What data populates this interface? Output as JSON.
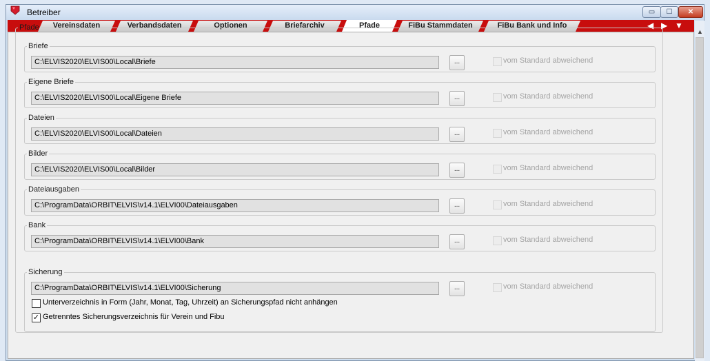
{
  "window": {
    "title": "Betreiber",
    "buttons": {
      "minimize": "▭",
      "maximize": "☐",
      "close": "✕"
    }
  },
  "tabs": [
    {
      "label": "Vereinsdaten",
      "active": false
    },
    {
      "label": "Verbandsdaten",
      "active": false
    },
    {
      "label": "Optionen",
      "active": false
    },
    {
      "label": "Briefarchiv",
      "active": false
    },
    {
      "label": "Pfade",
      "active": true
    },
    {
      "label": "FiBu Stammdaten",
      "active": false
    },
    {
      "label": "FiBu Bank und Info",
      "active": false
    }
  ],
  "tab_nav": {
    "prev": "◀",
    "next": "▶",
    "menu": "▼"
  },
  "scrollbar": {
    "up": "▲"
  },
  "pfade": {
    "title": "Pfade",
    "browse_label": "...",
    "std_label": "vom Standard abweichend",
    "groups": [
      {
        "title": "Briefe",
        "path": "C:\\ELVIS2020\\ELVIS00\\Local\\Briefe"
      },
      {
        "title": "Eigene Briefe",
        "path": "C:\\ELVIS2020\\ELVIS00\\Local\\Eigene Briefe"
      },
      {
        "title": "Dateien",
        "path": "C:\\ELVIS2020\\ELVIS00\\Local\\Dateien"
      },
      {
        "title": "Bilder",
        "path": "C:\\ELVIS2020\\ELVIS00\\Local\\Bilder"
      },
      {
        "title": "Dateiausgaben",
        "path": "C:\\ProgramData\\ORBIT\\ELVIS\\v14.1\\ELVI00\\Dateiausgaben"
      },
      {
        "title": "Bank",
        "path": "C:\\ProgramData\\ORBIT\\ELVIS\\v14.1\\ELVI00\\Bank"
      }
    ],
    "sicherung": {
      "title": "Sicherung",
      "path": "C:\\ProgramData\\ORBIT\\ELVIS\\v14.1\\ELVI00\\Sicherung",
      "option1": {
        "label": "Unterverzeichnis in Form (Jahr, Monat, Tag, Uhrzeit) an Sicherungspfad nicht anhängen",
        "checked": false,
        "mark": ""
      },
      "option2": {
        "label": "Getrenntes Sicherungsverzeichnis für Verein und Fibu",
        "checked": true,
        "mark": "✓"
      }
    }
  }
}
